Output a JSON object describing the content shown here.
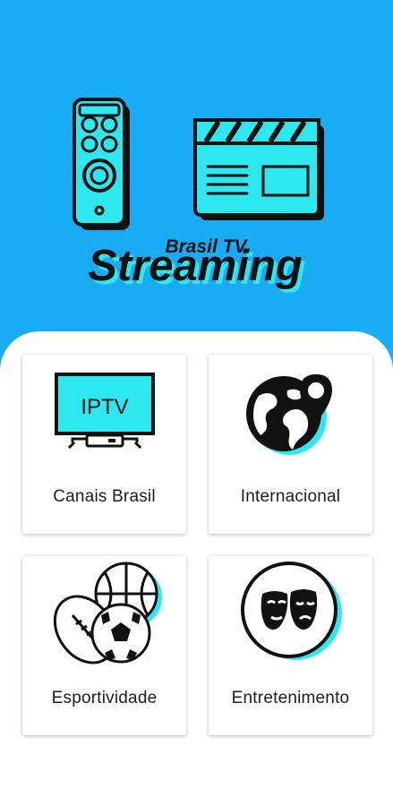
{
  "header": {
    "brand_small": "Brasil TV",
    "brand_large": "Streaming",
    "icons": [
      "tv-remote-icon",
      "clapperboard-icon"
    ]
  },
  "categories": [
    {
      "label": "Canais Brasil",
      "icon": "iptv-tv-icon",
      "tv_text": "IPTV"
    },
    {
      "label": "Internacional",
      "icon": "globe-pin-icon"
    },
    {
      "label": "Esportividade",
      "icon": "sports-balls-icon"
    },
    {
      "label": "Entretenimento",
      "icon": "theater-masks-icon"
    }
  ],
  "colors": {
    "background": "#1aabf5",
    "accent": "#2ee8f0",
    "panel": "#ffffff",
    "text": "#1c1c1c"
  }
}
